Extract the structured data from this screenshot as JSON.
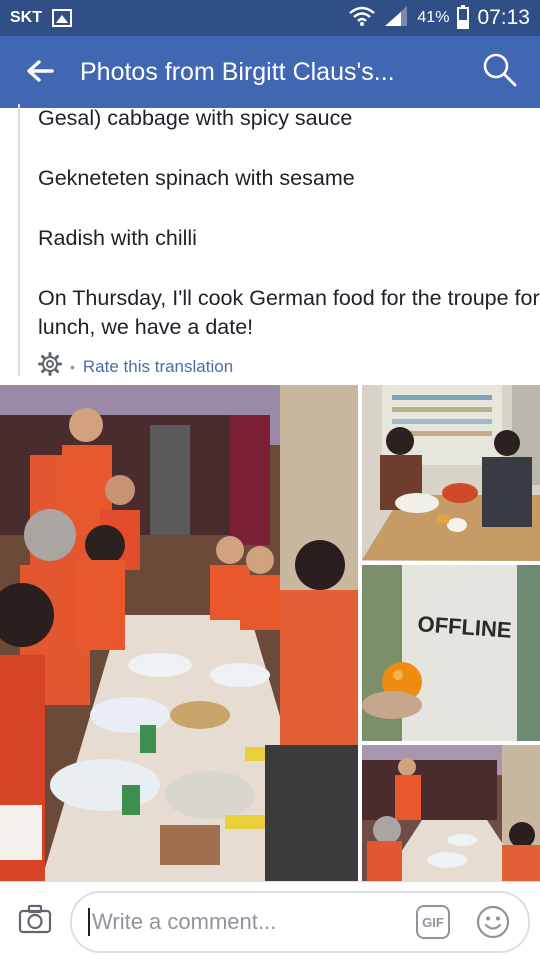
{
  "status_bar": {
    "carrier": "SKT",
    "battery_percent_text": "41%",
    "battery_level": 0.41,
    "time": "07:13",
    "icons": [
      "gallery-icon",
      "wifi-icon",
      "signal-icon",
      "battery-icon"
    ]
  },
  "app_bar": {
    "title": "Photos from Birgitt Claus's...",
    "icons": [
      "back-arrow-icon",
      "search-icon"
    ]
  },
  "post": {
    "lines": [
      "Gesal) cabbage with spicy sauce",
      "Gekneteten spinach with sesame",
      "Radish with chilli",
      "On Thursday, I'll cook German food for the troupe for lunch, we have a date!"
    ],
    "translation_settings_icon": "gear-icon",
    "rate_translation": "Rate this translation"
  },
  "photos": {
    "count": 4,
    "shirt_text": "OFFLINE"
  },
  "comment_bar": {
    "placeholder": "Write a comment...",
    "gif_label": "GIF",
    "icons": [
      "camera-icon",
      "gif-icon",
      "sticker-smiley-icon"
    ]
  },
  "colors": {
    "status_bar": "#2f4f86",
    "app_bar": "#4267b2",
    "link": "#4b6ea6",
    "muted": "#90949c"
  }
}
